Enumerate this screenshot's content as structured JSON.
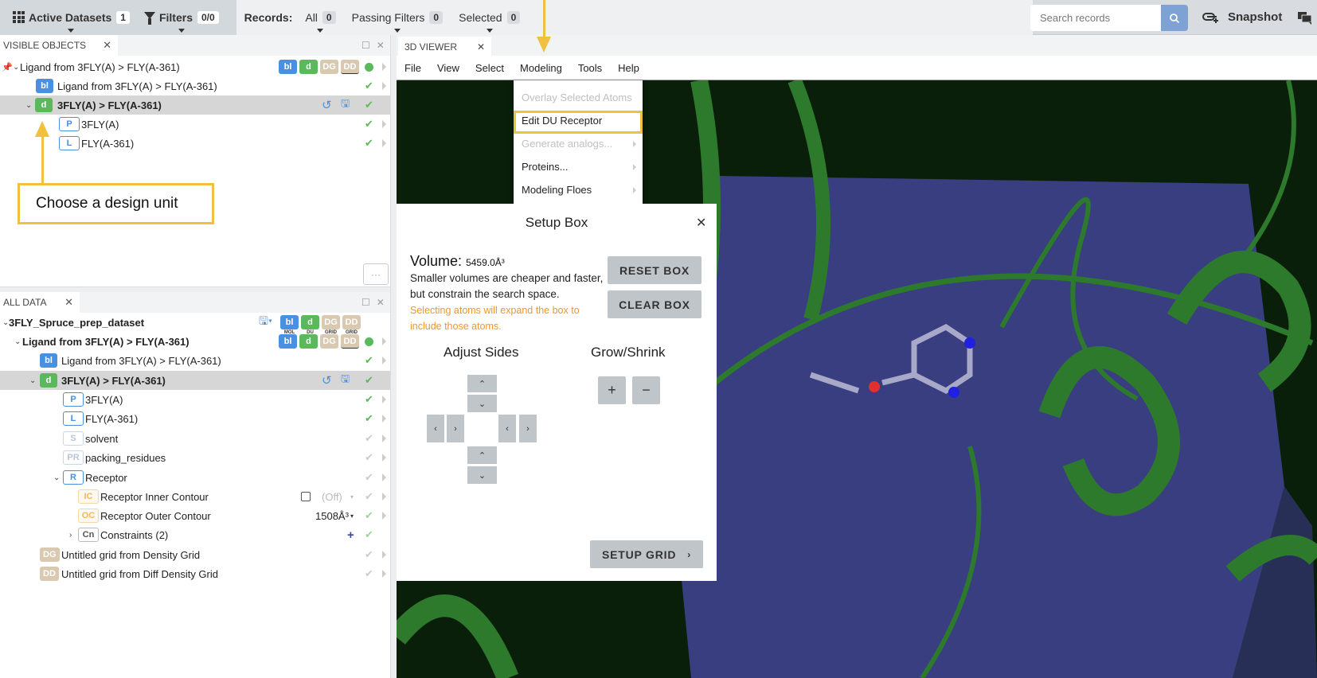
{
  "topbar": {
    "active_datasets_label": "Active Datasets",
    "active_datasets_count": "1",
    "filters_label": "Filters",
    "filters_count": "0/0",
    "records_label": "Records:",
    "all_label": "All",
    "all_count": "0",
    "passing_label": "Passing Filters",
    "passing_count": "0",
    "selected_label": "Selected",
    "selected_count": "0",
    "search_placeholder": "Search records",
    "snapshot_label": "Snapshot"
  },
  "visible_objects": {
    "tab_label": "VISIBLE OBJECTS",
    "rows": [
      {
        "label": "Ligand from 3FLY(A) > FLY(A-361)",
        "tags": [
          "bl",
          "d",
          "DG",
          "DD"
        ]
      },
      {
        "label": "Ligand from 3FLY(A) > FLY(A-361)",
        "tag": "bl"
      },
      {
        "label": "3FLY(A) > FLY(A-361)",
        "tag": "d"
      },
      {
        "label": "3FLY(A)",
        "tag": "P"
      },
      {
        "label": "FLY(A-361)",
        "tag": "L"
      }
    ]
  },
  "annotation": {
    "choose_design_unit": "Choose a design unit"
  },
  "more_button": "···",
  "all_data": {
    "tab_label": "ALL DATA",
    "dataset_name": "3FLY_Spruce_prep_dataset",
    "dataset_tag_captions": [
      "MOL",
      "DU",
      "GRID",
      "GRID"
    ],
    "rows": [
      {
        "label": "Ligand from 3FLY(A) > FLY(A-361)",
        "tags": [
          "bl",
          "d",
          "DG",
          "DD"
        ]
      },
      {
        "label": "Ligand from 3FLY(A) > FLY(A-361)",
        "tag": "bl"
      },
      {
        "label": "3FLY(A) > FLY(A-361)",
        "tag": "d"
      },
      {
        "label": "3FLY(A)",
        "tag": "P"
      },
      {
        "label": "FLY(A-361)",
        "tag": "L"
      },
      {
        "label": "solvent",
        "tag": "S"
      },
      {
        "label": "packing_residues",
        "tag": "PR"
      },
      {
        "label": "Receptor",
        "tag": "R"
      },
      {
        "label": "Receptor Inner Contour",
        "tag": "IC",
        "value": "(Off)"
      },
      {
        "label": "Receptor Outer Contour",
        "tag": "OC",
        "value": "1508Å³"
      },
      {
        "label": "Constraints (2)",
        "tag": "Cn"
      },
      {
        "label": "Untitled grid from Density Grid",
        "tag": "DG"
      },
      {
        "label": "Untitled grid from Diff Density Grid",
        "tag": "DD"
      }
    ]
  },
  "viewer": {
    "tab_label": "3D VIEWER",
    "menu": [
      "File",
      "View",
      "Select",
      "Modeling",
      "Tools",
      "Help"
    ],
    "modeling_menu": [
      {
        "label": "Overlay Selected Atoms",
        "disabled": true
      },
      {
        "label": "Edit DU Receptor",
        "highlighted": true
      },
      {
        "label": "Generate analogs...",
        "disabled": true,
        "submenu": true
      },
      {
        "label": "Proteins...",
        "submenu": true
      },
      {
        "label": "Modeling Floes",
        "submenu": true
      }
    ]
  },
  "setup_box": {
    "title": "Setup Box",
    "volume_label": "Volume:",
    "volume_value": "5459.0Å³",
    "description": "Smaller volumes are cheaper and faster, but constrain the search space.",
    "hint": "Selecting atoms will expand the box to include those atoms.",
    "reset_label": "RESET BOX",
    "clear_label": "CLEAR BOX",
    "adjust_title": "Adjust Sides",
    "grow_title": "Grow/Shrink",
    "setup_grid_label": "SETUP GRID"
  },
  "colors": {
    "annotation": "#f0c040",
    "accent_blue": "#4a90e2",
    "accent_green": "#5cb85c",
    "hint_orange": "#f0962a"
  }
}
